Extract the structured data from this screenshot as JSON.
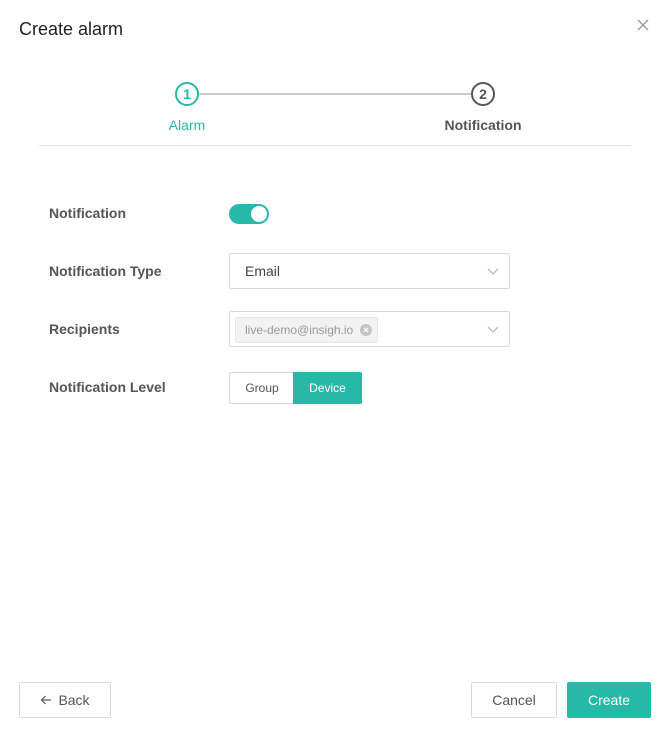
{
  "dialog": {
    "title": "Create alarm",
    "close_icon": "close-icon"
  },
  "steps": [
    {
      "number": "1",
      "label": "Alarm",
      "state": "active"
    },
    {
      "number": "2",
      "label": "Notification",
      "state": "pending"
    }
  ],
  "form": {
    "notification": {
      "label": "Notification",
      "enabled": true
    },
    "notification_type": {
      "label": "Notification Type",
      "value": "Email"
    },
    "recipients": {
      "label": "Recipients",
      "tags": [
        "live-demo@insigh.io"
      ]
    },
    "notification_level": {
      "label": "Notification Level",
      "options": [
        "Group",
        "Device"
      ],
      "selected": "Device"
    }
  },
  "footer": {
    "back_label": "Back",
    "cancel_label": "Cancel",
    "create_label": "Create"
  },
  "colors": {
    "accent": "#26b9a8",
    "border": "#d9d9d9"
  }
}
